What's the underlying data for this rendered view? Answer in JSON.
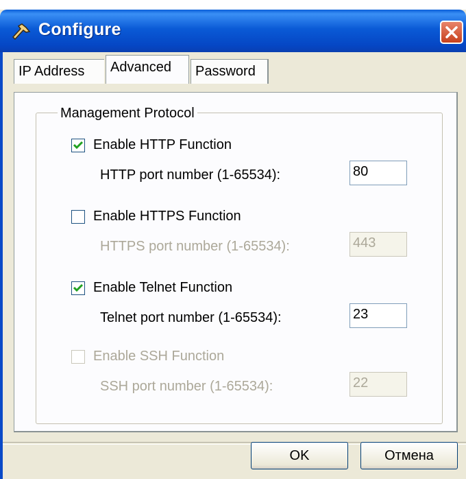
{
  "window": {
    "title": "Configure",
    "title_icon": "wrench-icon",
    "close_icon": "close-icon"
  },
  "tabs": [
    {
      "label": "IP Address",
      "active": false
    },
    {
      "label": "Advanced",
      "active": true
    },
    {
      "label": "Password",
      "active": false
    }
  ],
  "group": {
    "legend": "Management Protocol",
    "options": [
      {
        "checkbox_label": "Enable HTTP Function",
        "checked": true,
        "enabled": true,
        "port_label": "HTTP port number (1-65534):",
        "port_value": "80",
        "port_enabled": true
      },
      {
        "checkbox_label": "Enable HTTPS Function",
        "checked": false,
        "enabled": true,
        "port_label": "HTTPS port number (1-65534):",
        "port_value": "443",
        "port_enabled": false
      },
      {
        "checkbox_label": "Enable Telnet Function",
        "checked": true,
        "enabled": true,
        "port_label": "Telnet port number (1-65534):",
        "port_value": "23",
        "port_enabled": true
      },
      {
        "checkbox_label": "Enable SSH Function",
        "checked": false,
        "enabled": false,
        "port_label": "SSH port number (1-65534):",
        "port_value": "22",
        "port_enabled": false
      }
    ]
  },
  "buttons": {
    "ok": "OK",
    "cancel": "Отмена"
  },
  "colors": {
    "titlebar": "#0a5ad6",
    "dialog_bg": "#ece9d8",
    "disabled_text": "#aca899",
    "close_button": "#c7411d"
  }
}
